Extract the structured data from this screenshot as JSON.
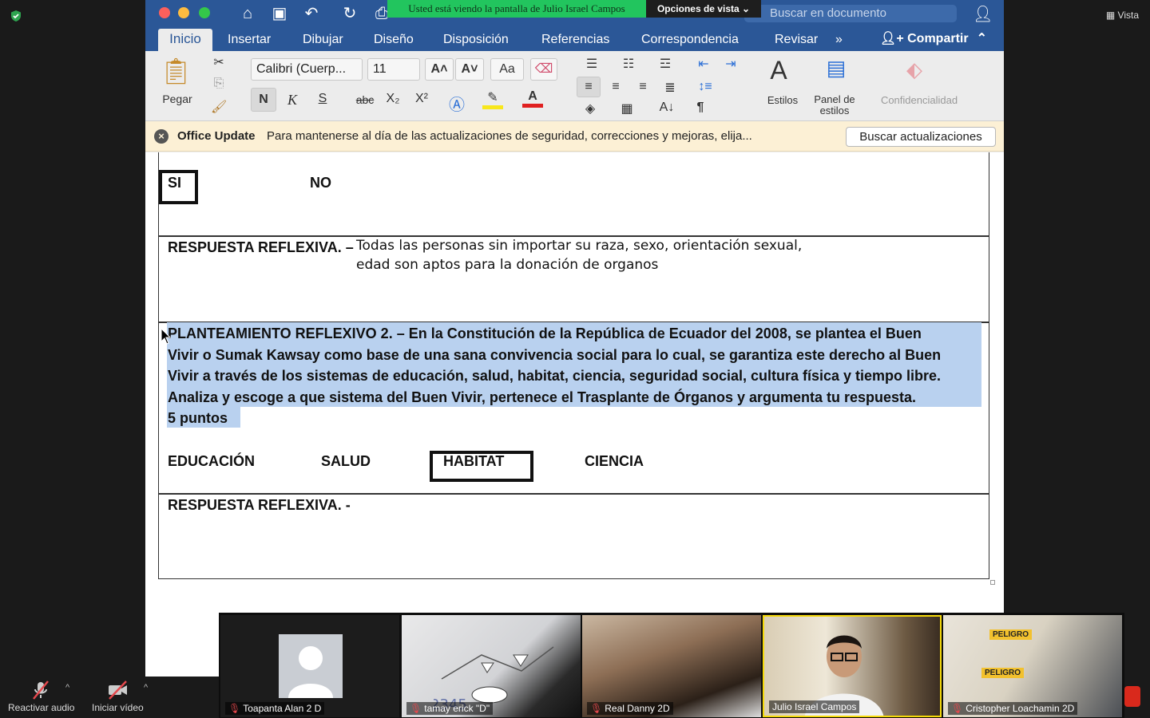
{
  "zoom": {
    "share_banner": "Usted está viendo la pantalla de Julio Israel Campos",
    "view_options": "Opciones de vista ⌄",
    "view_label": "Vista",
    "audio_label": "Reactivar audio",
    "video_label": "Iniciar vídeo",
    "participants": [
      {
        "name": "Toapanta Alan 2 D",
        "muted": true
      },
      {
        "name": "tamay erick \"D\"",
        "muted": true
      },
      {
        "name": "Real Danny 2D",
        "muted": true
      },
      {
        "name": "Julio Israel Campos",
        "muted": false
      },
      {
        "name": "Cristopher Loachamin 2D",
        "muted": true
      }
    ]
  },
  "word": {
    "search_placeholder": "Buscar en documento",
    "menu": [
      "Inicio",
      "Insertar",
      "Dibujar",
      "Diseño",
      "Disposición",
      "Referencias",
      "Correspondencia",
      "Revisar",
      "»"
    ],
    "share": "Compartir",
    "ribbon": {
      "paste": "Pegar",
      "font_name": "Calibri (Cuerp...",
      "font_size": "11",
      "bold": "N",
      "italic": "K",
      "underline": "S",
      "strike": "abc",
      "styles": "Estilos",
      "styles_pane": "Panel de estilos",
      "confidential": "Confidencialidad"
    },
    "notification": {
      "title": "Office Update",
      "text": "Para mantenerse al día de las actualizaciones de seguridad, correcciones y mejoras, elija...",
      "button": "Buscar actualizaciones"
    }
  },
  "document": {
    "yes": "SI",
    "no": "NO",
    "resp1_label": "RESPUESTA REFLEXIVA. –",
    "resp1_text_1": "Todas las personas sin importar su raza, sexo, orientación sexual,",
    "resp1_text_2": "edad son aptos para la donación de organos",
    "q2_line1": "PLANTEAMIENTO REFLEXIVO 2. – En la Constitución de la República de Ecuador del 2008, se plantea el Buen",
    "q2_line2": "Vivir o Sumak Kawsay como base de una sana convivencia social para lo cual, se  garantiza este derecho al Buen",
    "q2_line3": "Vivir a través de los sistemas de educación, salud, habitat, ciencia, seguridad social, cultura física y tiempo libre.",
    "q2_line4": "Analiza y escoge a que sistema del Buen Vivir, pertenece el Trasplante de Órganos y argumenta tu respuesta.",
    "q2_line5": "5 puntos",
    "options": [
      "EDUCACIÓN",
      "SALUD",
      "HABITAT",
      "CIENCIA"
    ],
    "resp2_label": "RESPUESTA REFLEXIVA. -"
  }
}
